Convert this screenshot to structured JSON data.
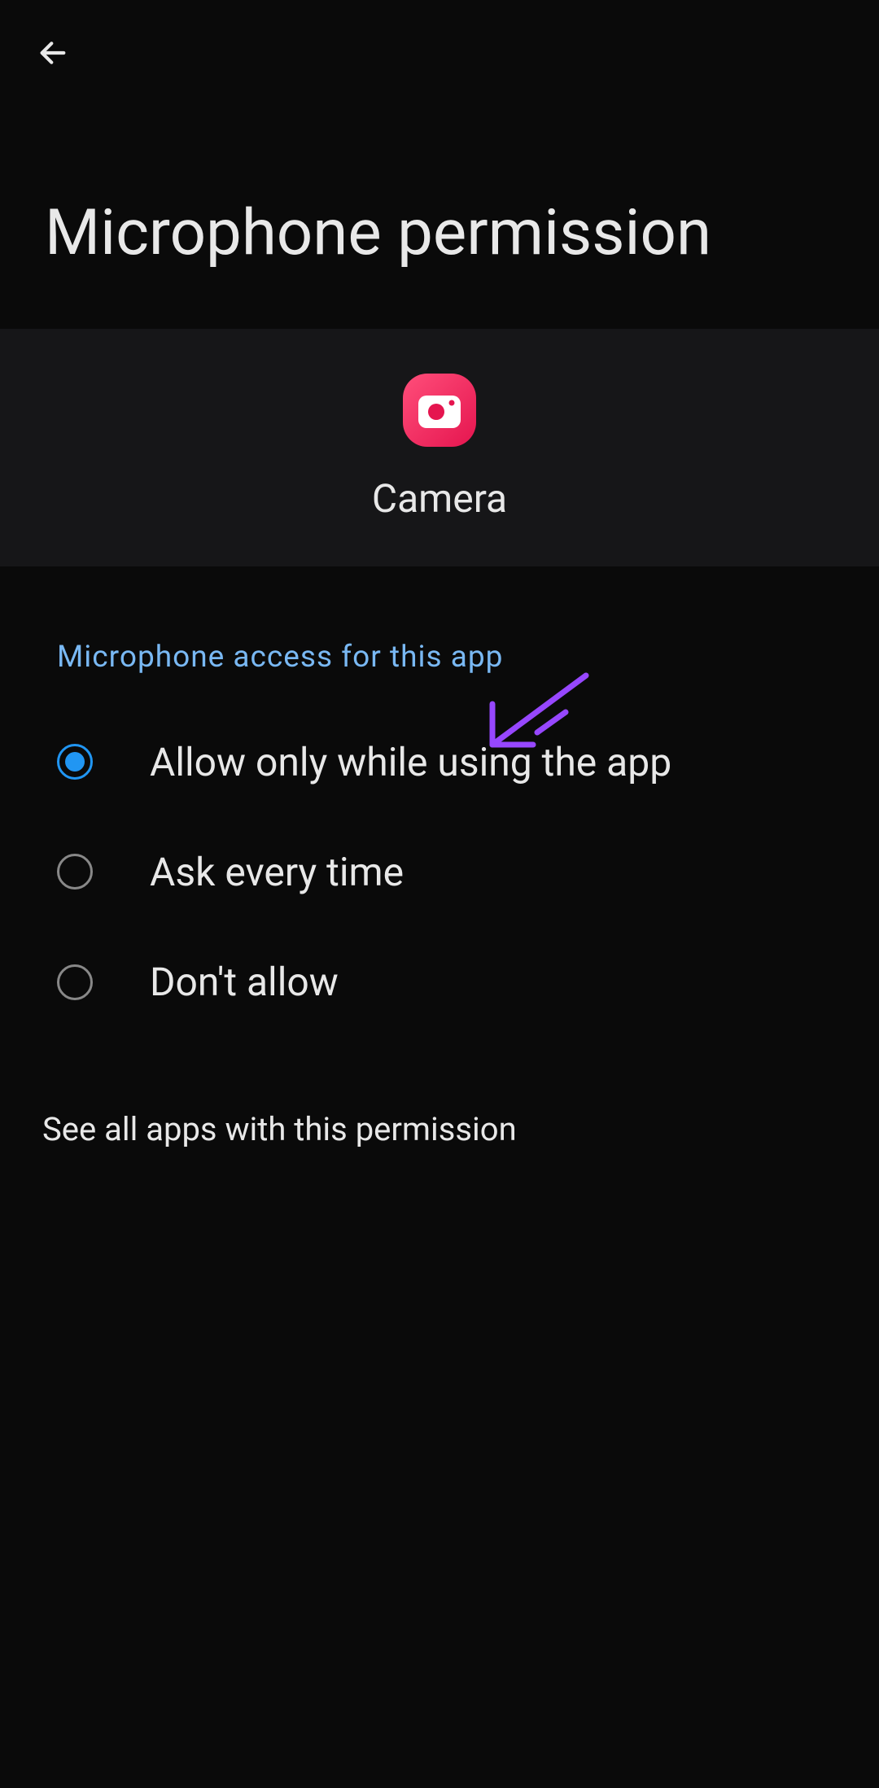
{
  "header": {
    "title": "Microphone permission"
  },
  "app": {
    "name": "Camera",
    "icon_name": "camera-app-icon"
  },
  "section": {
    "header": "Microphone access for this app"
  },
  "options": [
    {
      "label": "Allow only while using the app",
      "selected": true
    },
    {
      "label": "Ask every time",
      "selected": false
    },
    {
      "label": "Don't allow",
      "selected": false
    }
  ],
  "footer": {
    "link": "See all apps with this permission"
  },
  "annotation": {
    "color": "#9747ff"
  }
}
